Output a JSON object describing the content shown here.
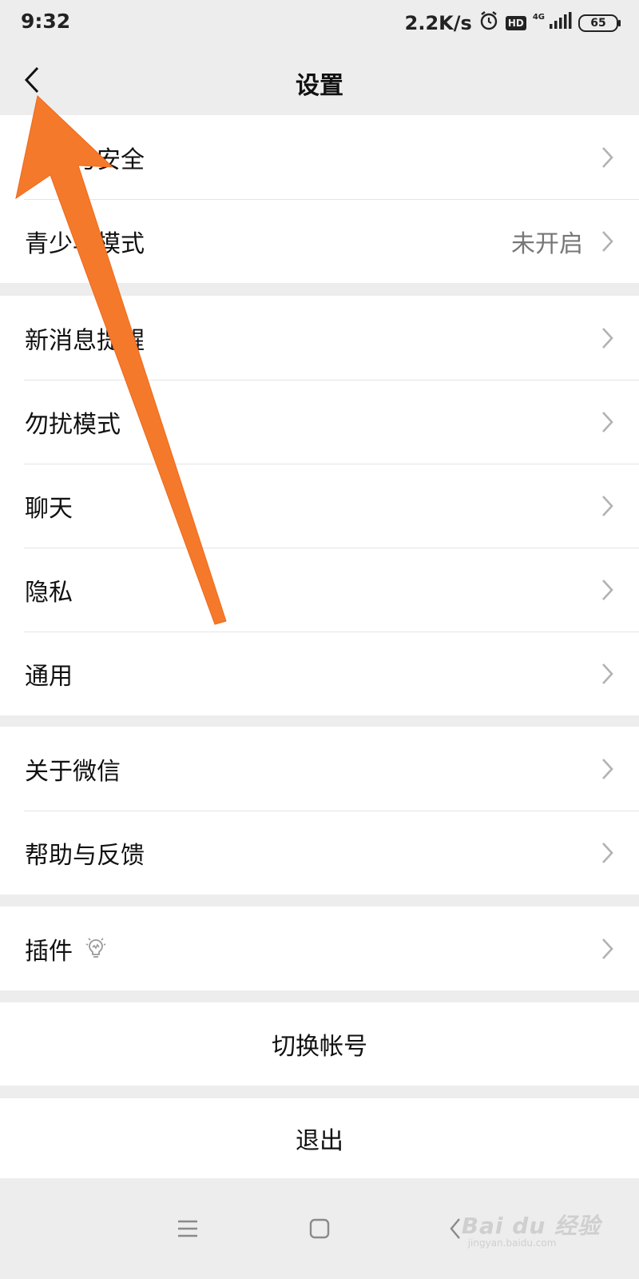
{
  "status_bar": {
    "time": "9:32",
    "net_speed": "2.2K/s",
    "hd": "HD",
    "network": "4G",
    "battery": "65",
    "icons": [
      "alarm-icon",
      "signal-icon"
    ]
  },
  "header": {
    "title": "设置",
    "back_icon": "chevron-left-icon"
  },
  "groups": [
    {
      "items": [
        {
          "label": "帐号与安全",
          "value": ""
        },
        {
          "label": "青少年模式",
          "value": "未开启"
        }
      ]
    },
    {
      "items": [
        {
          "label": "新消息提醒",
          "value": ""
        },
        {
          "label": "勿扰模式",
          "value": ""
        },
        {
          "label": "聊天",
          "value": ""
        },
        {
          "label": "隐私",
          "value": ""
        },
        {
          "label": "通用",
          "value": ""
        }
      ]
    },
    {
      "items": [
        {
          "label": "关于微信",
          "value": ""
        },
        {
          "label": "帮助与反馈",
          "value": ""
        }
      ]
    },
    {
      "items": [
        {
          "label": "插件",
          "value": "",
          "icon": "lightbulb-icon"
        }
      ]
    }
  ],
  "actions": {
    "switch_account": "切换帐号",
    "logout": "退出"
  },
  "system_nav": {
    "icons": [
      "menu-icon",
      "home-icon",
      "back-icon"
    ]
  },
  "watermark": {
    "text": "Bai du 经验",
    "sub": "jingyan.baidu.com"
  },
  "colors": {
    "background": "#ededed",
    "card": "#ffffff",
    "annotation_arrow": "#f5792a",
    "secondary_text": "#777777"
  }
}
